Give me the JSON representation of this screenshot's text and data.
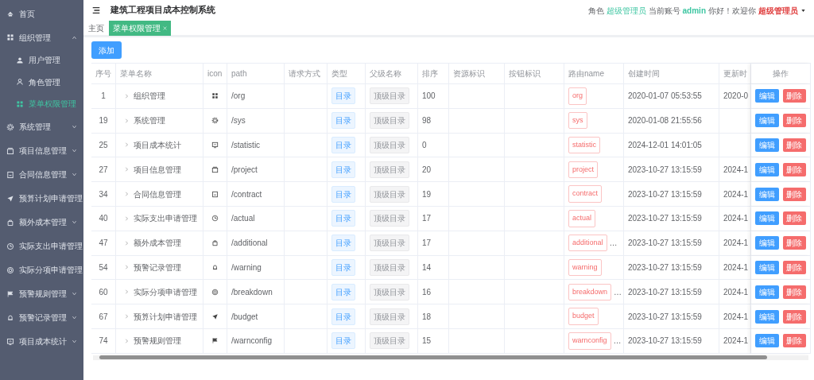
{
  "sidebar": {
    "items": [
      {
        "label": "首页",
        "kind": "link",
        "selected": false
      },
      {
        "label": "组织管理",
        "kind": "group",
        "expanded": true,
        "children": [
          {
            "label": "用户管理",
            "selected": false
          },
          {
            "label": "角色管理",
            "selected": false
          },
          {
            "label": "菜单权限管理",
            "selected": true
          }
        ]
      },
      {
        "label": "系统管理",
        "kind": "group",
        "expanded": false
      },
      {
        "label": "项目信息管理",
        "kind": "group",
        "expanded": false
      },
      {
        "label": "合同信息管理",
        "kind": "group",
        "expanded": false
      },
      {
        "label": "预算计划申请管理",
        "kind": "group",
        "expanded": false
      },
      {
        "label": "额外成本管理",
        "kind": "group",
        "expanded": false
      },
      {
        "label": "实际支出申请管理",
        "kind": "group",
        "expanded": false
      },
      {
        "label": "实际分项申请管理",
        "kind": "group",
        "expanded": false
      },
      {
        "label": "预警规则管理",
        "kind": "group",
        "expanded": false
      },
      {
        "label": "预警记录管理",
        "kind": "group",
        "expanded": false
      },
      {
        "label": "项目成本统计",
        "kind": "group",
        "expanded": false
      }
    ]
  },
  "header": {
    "title": "建筑工程项目成本控制系统",
    "role_label": "角色",
    "role": "超级管理员",
    "account_label": "当前账号",
    "account": "admin",
    "greeting": "你好！欢迎你",
    "user": "超级管理员"
  },
  "breadcrumb": {
    "home": "主页",
    "tabs": [
      {
        "label": "菜单权限管理",
        "selected": true
      }
    ]
  },
  "add_button": "添加",
  "table": {
    "columns": [
      "序号",
      "菜单名称",
      "icon",
      "path",
      "请求方式",
      "类型",
      "父级名称",
      "排序",
      "资源标识",
      "按钮标识",
      "路由name",
      "创建时间",
      "更新时",
      "操作"
    ],
    "rows": [
      {
        "id": "1",
        "name": "组织管理",
        "path": "/org",
        "type": "目录",
        "parent": "顶级目录",
        "sort": "100",
        "route": "org",
        "created": "2020-01-07 05:53:55",
        "updated": "2020-0",
        "actions": [
          "编辑",
          "删除"
        ]
      },
      {
        "id": "19",
        "name": "系统管理",
        "path": "/sys",
        "type": "目录",
        "parent": "顶级目录",
        "sort": "98",
        "route": "sys",
        "created": "2020-01-08 21:55:56",
        "actions": [
          "编辑",
          "删除"
        ]
      },
      {
        "id": "25",
        "name": "项目成本统计",
        "path": "/statistic",
        "type": "目录",
        "parent": "顶级目录",
        "sort": "0",
        "route": "statistic",
        "created": "2024-12-01 14:01:05",
        "actions": [
          "编辑",
          "删除"
        ]
      },
      {
        "id": "27",
        "name": "项目信息管理",
        "path": "/project",
        "type": "目录",
        "parent": "顶级目录",
        "sort": "20",
        "route": "project",
        "created": "2023-10-27 13:15:59",
        "updated": "2024-1",
        "actions": [
          "编辑",
          "删除"
        ]
      },
      {
        "id": "34",
        "name": "合同信息管理",
        "path": "/contract",
        "type": "目录",
        "parent": "顶级目录",
        "sort": "19",
        "route": "contract",
        "created": "2023-10-27 13:15:59",
        "updated": "2024-1",
        "actions": [
          "编辑",
          "删除"
        ]
      },
      {
        "id": "40",
        "name": "实际支出申请管理",
        "path": "/actual",
        "type": "目录",
        "parent": "顶级目录",
        "sort": "17",
        "route": "actual",
        "created": "2023-10-27 13:15:59",
        "updated": "2024-1",
        "actions": [
          "编辑",
          "删除"
        ]
      },
      {
        "id": "47",
        "name": "额外成本管理",
        "path": "/additional",
        "type": "目录",
        "parent": "顶级目录",
        "sort": "17",
        "route": "additional",
        "route_more": "…",
        "created": "2023-10-27 13:15:59",
        "updated": "2024-1",
        "actions": [
          "编辑",
          "删除"
        ]
      },
      {
        "id": "54",
        "name": "预警记录管理",
        "path": "/warning",
        "type": "目录",
        "parent": "顶级目录",
        "sort": "14",
        "route": "warning",
        "created": "2023-10-27 13:15:59",
        "updated": "2024-1",
        "actions": [
          "编辑",
          "删除"
        ]
      },
      {
        "id": "60",
        "name": "实际分项申请管理",
        "path": "/breakdown",
        "type": "目录",
        "parent": "顶级目录",
        "sort": "16",
        "route": "breakdown",
        "route_more": "…",
        "created": "2023-10-27 13:15:59",
        "updated": "2024-1",
        "actions": [
          "编辑",
          "删除"
        ]
      },
      {
        "id": "67",
        "name": "预算计划申请管理",
        "path": "/budget",
        "type": "目录",
        "parent": "顶级目录",
        "sort": "18",
        "route": "budget",
        "created": "2023-10-27 13:15:59",
        "updated": "2024-1",
        "actions": [
          "编辑",
          "删除"
        ]
      },
      {
        "id": "74",
        "name": "预警规则管理",
        "path": "/warnconfig",
        "type": "目录",
        "parent": "顶级目录",
        "sort": "15",
        "route": "warnconfig",
        "route_more": "…",
        "created": "2023-10-27 13:15:59",
        "updated": "2024-1",
        "actions": [
          "编辑",
          "删除"
        ]
      }
    ]
  }
}
